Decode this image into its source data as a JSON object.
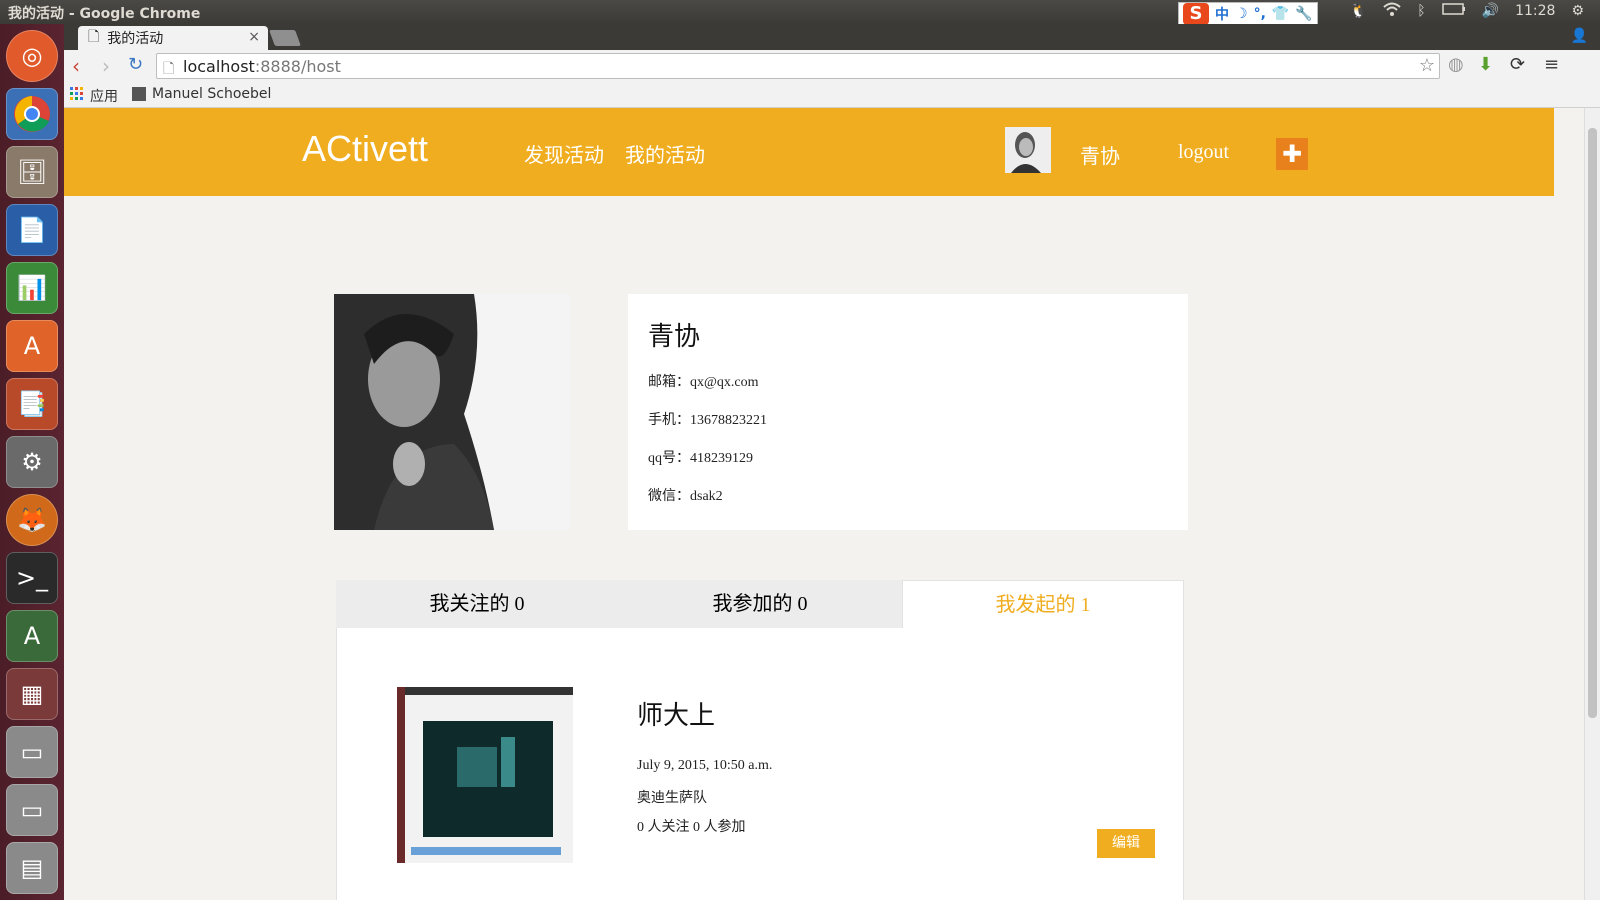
{
  "os": {
    "window_title": "我的活动 - Google Chrome",
    "ime": {
      "logo": "S",
      "items": [
        "中",
        "☽",
        "°,",
        "👕",
        "🔧"
      ]
    },
    "clock": "11:28"
  },
  "browser": {
    "tab_title": "我的活动",
    "tab_close": "×",
    "url_host": "localhost",
    "url_rest": ":8888/host",
    "bookmarks": {
      "apps_label": "应用",
      "item1_label": "Manuel Schoebel"
    }
  },
  "site": {
    "logo": "ACtivett",
    "nav": {
      "discover": "发现活动",
      "my_events": "我的活动"
    },
    "username": "青协",
    "logout": "logout",
    "add": "✚"
  },
  "profile": {
    "name": "青协",
    "email": "邮箱：qx@qx.com",
    "phone": "手机：13678823221",
    "qq": "qq号：418239129",
    "wechat": "微信：dsak2"
  },
  "tabs": {
    "following": "我关注的 0",
    "joined": "我参加的 0",
    "created": "我发起的 1"
  },
  "event": {
    "title": "师大上",
    "datetime": "July 9, 2015, 10:50 a.m.",
    "location": "奥迪生萨队",
    "stats": "0 人关注 0 人参加",
    "edit": "编辑"
  }
}
